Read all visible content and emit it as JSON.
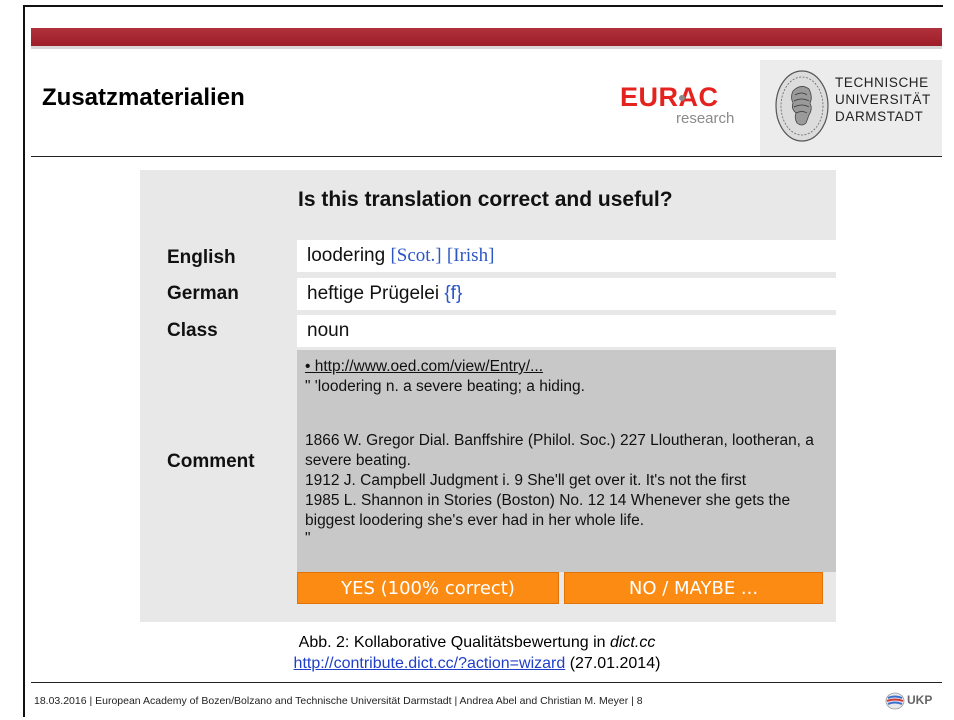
{
  "slide": {
    "title": "Zusatzmaterialien",
    "caption": {
      "prefix": "Abb. 2: Kollaborative Qualitätsbewertung in ",
      "italic": "dict.cc",
      "url": "http://contribute.dict.cc/?action=wizard",
      "url_suffix": " (27.01.2014)"
    },
    "footer": "18.03.2016  |  European Academy of Bozen/Bolzano and Technische Universität Darmstadt  |  Andrea Abel and Christian M. Meyer  |  8"
  },
  "logos": {
    "eurac_main": "EURAC",
    "eurac_sub": "research",
    "tud_line1": "TECHNISCHE",
    "tud_line2": "UNIVERSITÄT",
    "tud_line3": "DARMSTADT",
    "ukp": "UKP"
  },
  "panel": {
    "question": "Is this translation correct and useful?",
    "labels": {
      "english": "English",
      "german": "German",
      "class": "Class",
      "comment": "Comment"
    },
    "english": {
      "term": "loodering ",
      "tag1": "[Scot.]",
      "tag2": "[Irish]"
    },
    "german": {
      "term": "heftige Prügelei ",
      "tag": "{f}"
    },
    "class_value": "noun",
    "comment_lines": [
      "\" 'loodering n. a severe beating; a hiding.",
      "1866 W. Gregor Dial. Banffshire (Philol. Soc.) 227 Lloutheran, lootheran, a",
      "severe beating.",
      "1912 J. Campbell Judgment i. 9 She'll get over it. It's not the first",
      "1985 L. Shannon in Stories (Boston) No. 12 14 Whenever she gets the",
      "biggest loodering she's ever had in her whole life.",
      "\""
    ],
    "comment_link": "• http://www.oed.com/view/Entry/...",
    "buttons": {
      "yes": "YES (100% correct)",
      "no": "NO / MAYBE ..."
    }
  },
  "colors": {
    "header_bar": "#a3242f",
    "eurac_red": "#e4231f",
    "button_orange": "#fb8b13",
    "tag_blue": "#2a56c6",
    "link_blue": "#1f3fc9"
  }
}
